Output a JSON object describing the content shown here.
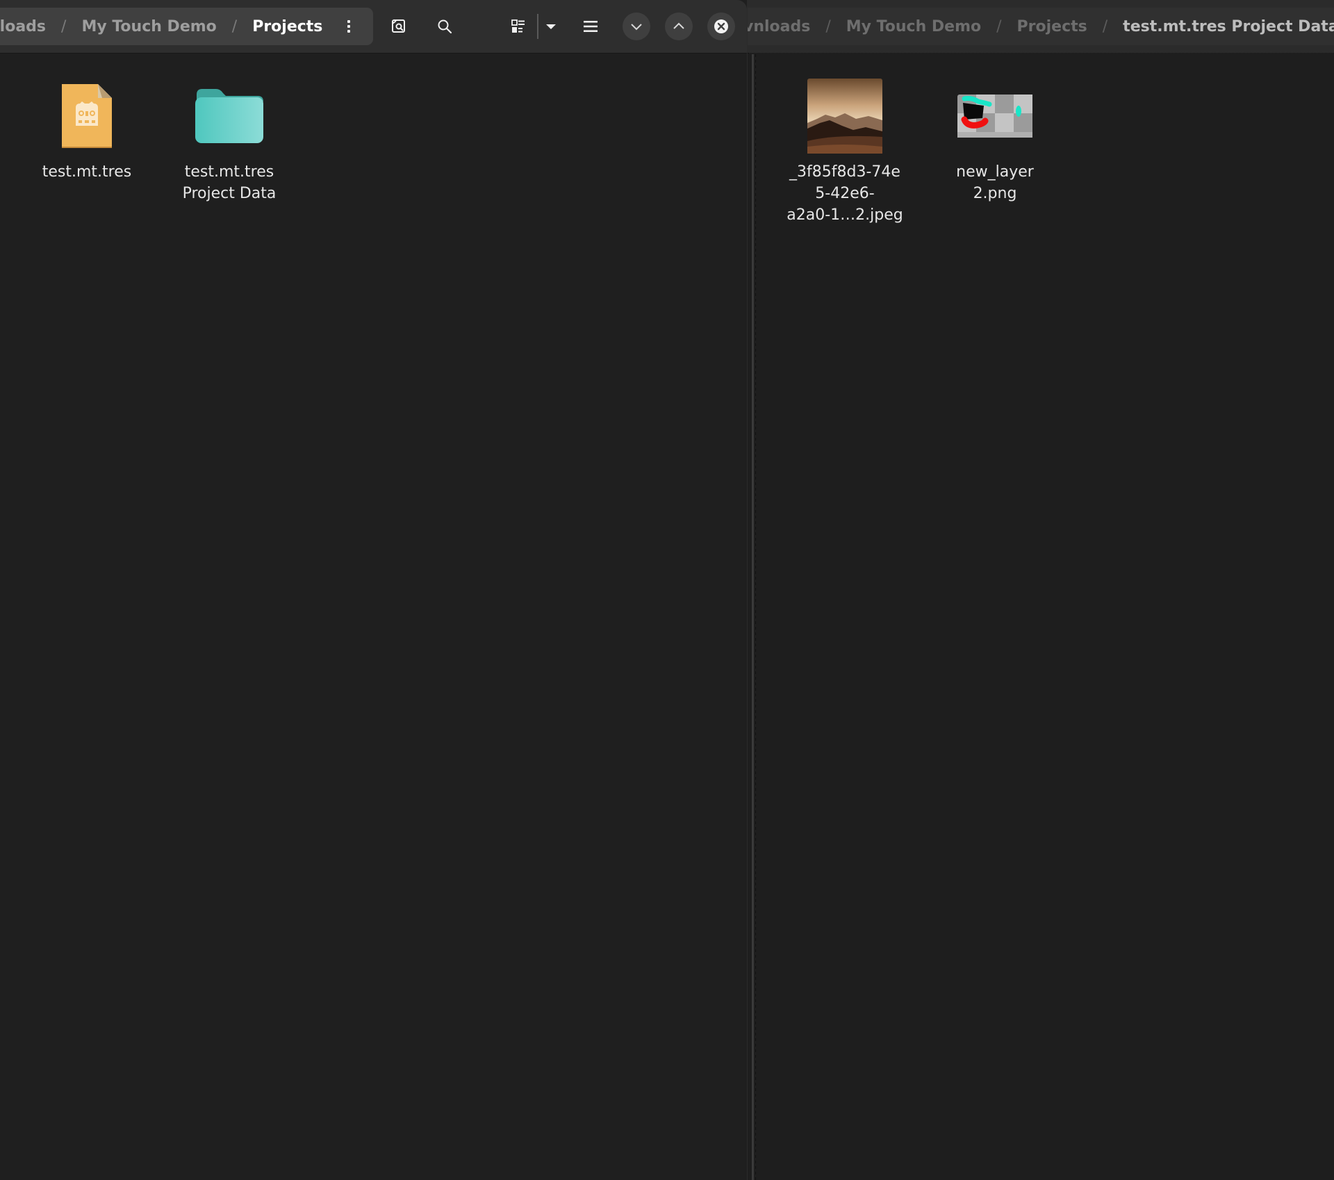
{
  "left_pane": {
    "breadcrumb": [
      {
        "label": "nloads",
        "current": false
      },
      {
        "label": "My Touch Demo",
        "current": false
      },
      {
        "label": "Projects",
        "current": true
      }
    ],
    "separator": "/",
    "toolbar": {
      "menu_icon": "vertical-ellipsis-icon",
      "buttons": [
        {
          "name": "find-in-folder-button",
          "icon": "image-search-icon"
        },
        {
          "name": "search-button",
          "icon": "search-icon"
        },
        {
          "name": "view-mode-button",
          "icon": "view-grid-list-icon"
        },
        {
          "name": "view-options-dropdown",
          "icon": "caret-down-icon"
        },
        {
          "name": "main-menu-button",
          "icon": "hamburger-menu-icon"
        },
        {
          "name": "minimize-button",
          "icon": "chevron-down-icon"
        },
        {
          "name": "maximize-button",
          "icon": "chevron-up-icon"
        },
        {
          "name": "close-button",
          "icon": "close-circle-icon"
        }
      ]
    },
    "items": [
      {
        "label": "test.mt.tres",
        "type": "godot-resource-file",
        "icon_color": "#f0b65a"
      },
      {
        "label": "test.mt.tres Project Data",
        "type": "folder",
        "icon_color": "#5fcdc4"
      }
    ]
  },
  "right_pane": {
    "breadcrumb": [
      {
        "label": "vnloads",
        "current": false
      },
      {
        "label": "My Touch Demo",
        "current": false
      },
      {
        "label": "Projects",
        "current": false
      },
      {
        "label": "test.mt.tres Project Data",
        "current": true
      }
    ],
    "separator": "/",
    "items": [
      {
        "label": "_3f85f8d3-74e5-42e6-a2a0-1…2.jpeg",
        "label_lines": [
          "_3f85f8d3-74e",
          "5-42e6-",
          "a2a0-1…2.jpeg"
        ],
        "type": "jpeg-image-thumbnail"
      },
      {
        "label": "new_layer2.png",
        "label_lines": [
          "new_layer",
          "2.png"
        ],
        "type": "png-image-thumbnail"
      }
    ]
  },
  "colors": {
    "background": "#1e1e1e",
    "headerbar": "#2e2e2e",
    "pathbar": "#404040",
    "text_primary": "#ffffff",
    "text_secondary": "#9e9e9e"
  }
}
